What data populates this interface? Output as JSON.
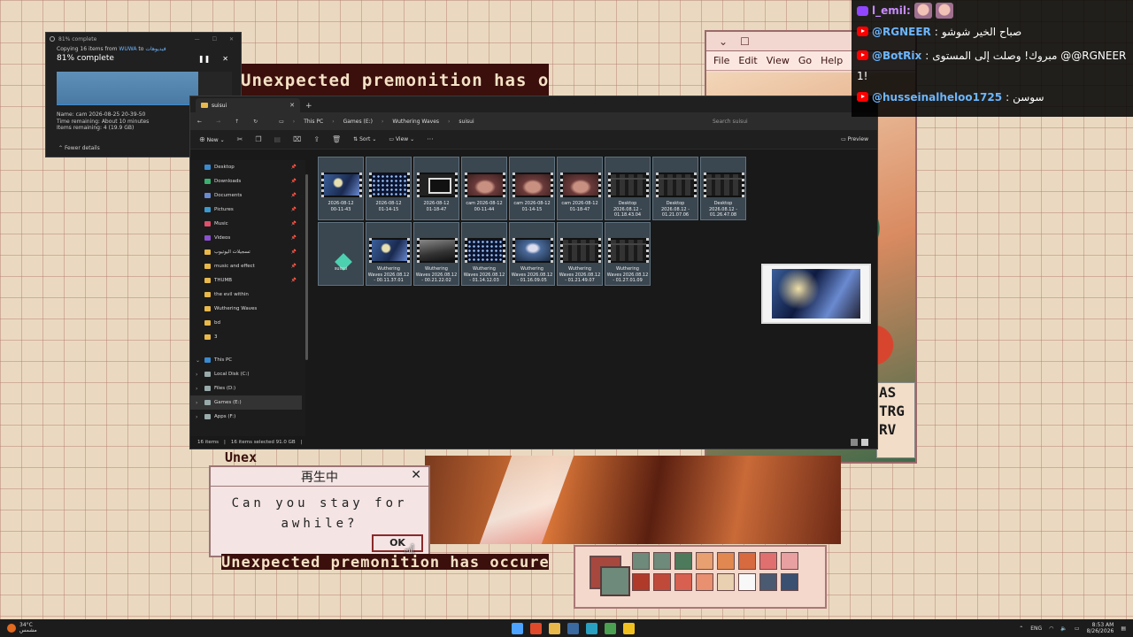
{
  "wallpaper": {
    "banner_top": "Unexpected premonition has occured",
    "banner_bottom": "Unexpected premonition has occured",
    "banner_under": "Unex",
    "art_window": {
      "menus": [
        "File",
        "Edit",
        "View",
        "Go",
        "Help"
      ],
      "letters": "AS\nTRG\nRV"
    },
    "dialog": {
      "title": "再生中",
      "message": "Can you stay for\nawhile?",
      "ok": "OK"
    },
    "palette_colors": [
      "#6d8a7a",
      "#6d8a7a",
      "#4c7a5a",
      "#e8a070",
      "#e08850",
      "#d86a40",
      "#e07070",
      "#e8a0a0",
      "#b03a2a",
      "#c04a3a",
      "#d86050",
      "#e89070",
      "#e8d0b0",
      "#f8f8f8",
      "#4a5a70",
      "#3a5070"
    ]
  },
  "copy_window": {
    "title": "81% complete",
    "copying_prefix": "Copying 16 items from",
    "source": "WUWA",
    "to_word": "to",
    "dest": "فيديوهات",
    "percent": "81% complete",
    "progress": 0.81,
    "name": "Name: cam 2026-08-25 20-39-50",
    "time": "Time remaining: About 10 minutes",
    "items": "Items remaining: 4 (19.9 GB)",
    "fewer": "Fewer details"
  },
  "explorer": {
    "tab": "suisui",
    "breadcrumb": [
      "This PC",
      "Games (E:)",
      "Wuthering Waves",
      "suisui"
    ],
    "search_placeholder": "Search suisui",
    "toolbar": {
      "new": "New",
      "sort": "Sort",
      "view": "View",
      "preview": "Preview"
    },
    "nav_quick": [
      {
        "label": "Desktop",
        "color": "#3a8ad0",
        "pinned": true
      },
      {
        "label": "Downloads",
        "color": "#3ab070",
        "pinned": true
      },
      {
        "label": "Documents",
        "color": "#6a8ad0",
        "pinned": true
      },
      {
        "label": "Pictures",
        "color": "#3a9ad0",
        "pinned": true
      },
      {
        "label": "Music",
        "color": "#e0506a",
        "pinned": true
      },
      {
        "label": "Videos",
        "color": "#8a50d0",
        "pinned": true
      },
      {
        "label": "تسجيلات اليوتيوب",
        "color": "#e8b84a",
        "pinned": true
      },
      {
        "label": "music and effect",
        "color": "#e8b84a",
        "pinned": true
      },
      {
        "label": "THUMB",
        "color": "#e8b84a",
        "pinned": true
      },
      {
        "label": "the evil within",
        "color": "#e8b84a",
        "pinned": false
      },
      {
        "label": "Wuthering Waves",
        "color": "#e8b84a",
        "pinned": false
      },
      {
        "label": "bd",
        "color": "#e8b84a",
        "pinned": false
      },
      {
        "label": "3",
        "color": "#e8b84a",
        "pinned": false
      }
    ],
    "nav_pc": [
      {
        "label": "This PC",
        "chev": "⌄"
      },
      {
        "label": "Local Disk (C:)",
        "chev": "›"
      },
      {
        "label": "Files (D:)",
        "chev": "›"
      },
      {
        "label": "Games (E:)",
        "chev": "›"
      },
      {
        "label": "Apps (F:)",
        "chev": "›"
      }
    ],
    "files": [
      {
        "name": "2026-08-12\n00-11-43",
        "theme": "blue"
      },
      {
        "name": "2026-08-12\n01-14-15",
        "theme": "dots"
      },
      {
        "name": "2026-08-12\n01-18-47",
        "theme": "dark"
      },
      {
        "name": "cam 2026-08-12\n00-11-44",
        "theme": "cam"
      },
      {
        "name": "cam 2026-08-12\n01-14-15",
        "theme": "cam"
      },
      {
        "name": "cam 2026-08-12\n01-18-47",
        "theme": "cam"
      },
      {
        "name": "Desktop\n2026.08.12 -\n01.18.43.04",
        "theme": "desk"
      },
      {
        "name": "Desktop\n2026.08.12 -\n01.21.07.06",
        "theme": "desk"
      },
      {
        "name": "Desktop\n2026.08.12 -\n01.26.47.08",
        "theme": "desk"
      },
      {
        "name": "suisui",
        "theme": "generic"
      },
      {
        "name": "Wuthering\nWaves 2026.08.12\n- 00.11.37.01",
        "theme": "blue"
      },
      {
        "name": "Wuthering\nWaves 2026.08.12\n- 00.21.22.02",
        "theme": "grey"
      },
      {
        "name": "Wuthering\nWaves 2026.08.12\n- 01.14.12.03",
        "theme": "dots"
      },
      {
        "name": "Wuthering\nWaves 2026.08.12\n- 01.16.09.05",
        "theme": "char"
      },
      {
        "name": "Wuthering\nWaves 2026.08.12\n- 01.21.49.07",
        "theme": "desk"
      },
      {
        "name": "Wuthering\nWaves 2026.08.12\n- 01.27.01.09",
        "theme": "desk"
      }
    ],
    "status": {
      "items": "16 items",
      "selected": "16 items selected  91.0 GB"
    }
  },
  "chat": {
    "first": {
      "user": "l_emil:"
    },
    "messages": [
      {
        "user": "@RGNEER",
        "text": "صباح الخير شوشو"
      },
      {
        "user": "@BotRix",
        "text": "مبروك! وصلت إلى المستوى @@RGNEER",
        "cont": "1!"
      },
      {
        "user": "@husseinalheloo1725",
        "text": "سوسن"
      }
    ]
  },
  "taskbar": {
    "temp": "34°C",
    "weather": "مشمس",
    "lang": "ENG",
    "time": "8:53 AM",
    "date": "8/26/2026",
    "app_colors": [
      "#4da3ff",
      "#e04a2a",
      "#e8b84a",
      "#3a6aa0",
      "#2aa0c0",
      "#4aa050",
      "#f0c020"
    ]
  }
}
